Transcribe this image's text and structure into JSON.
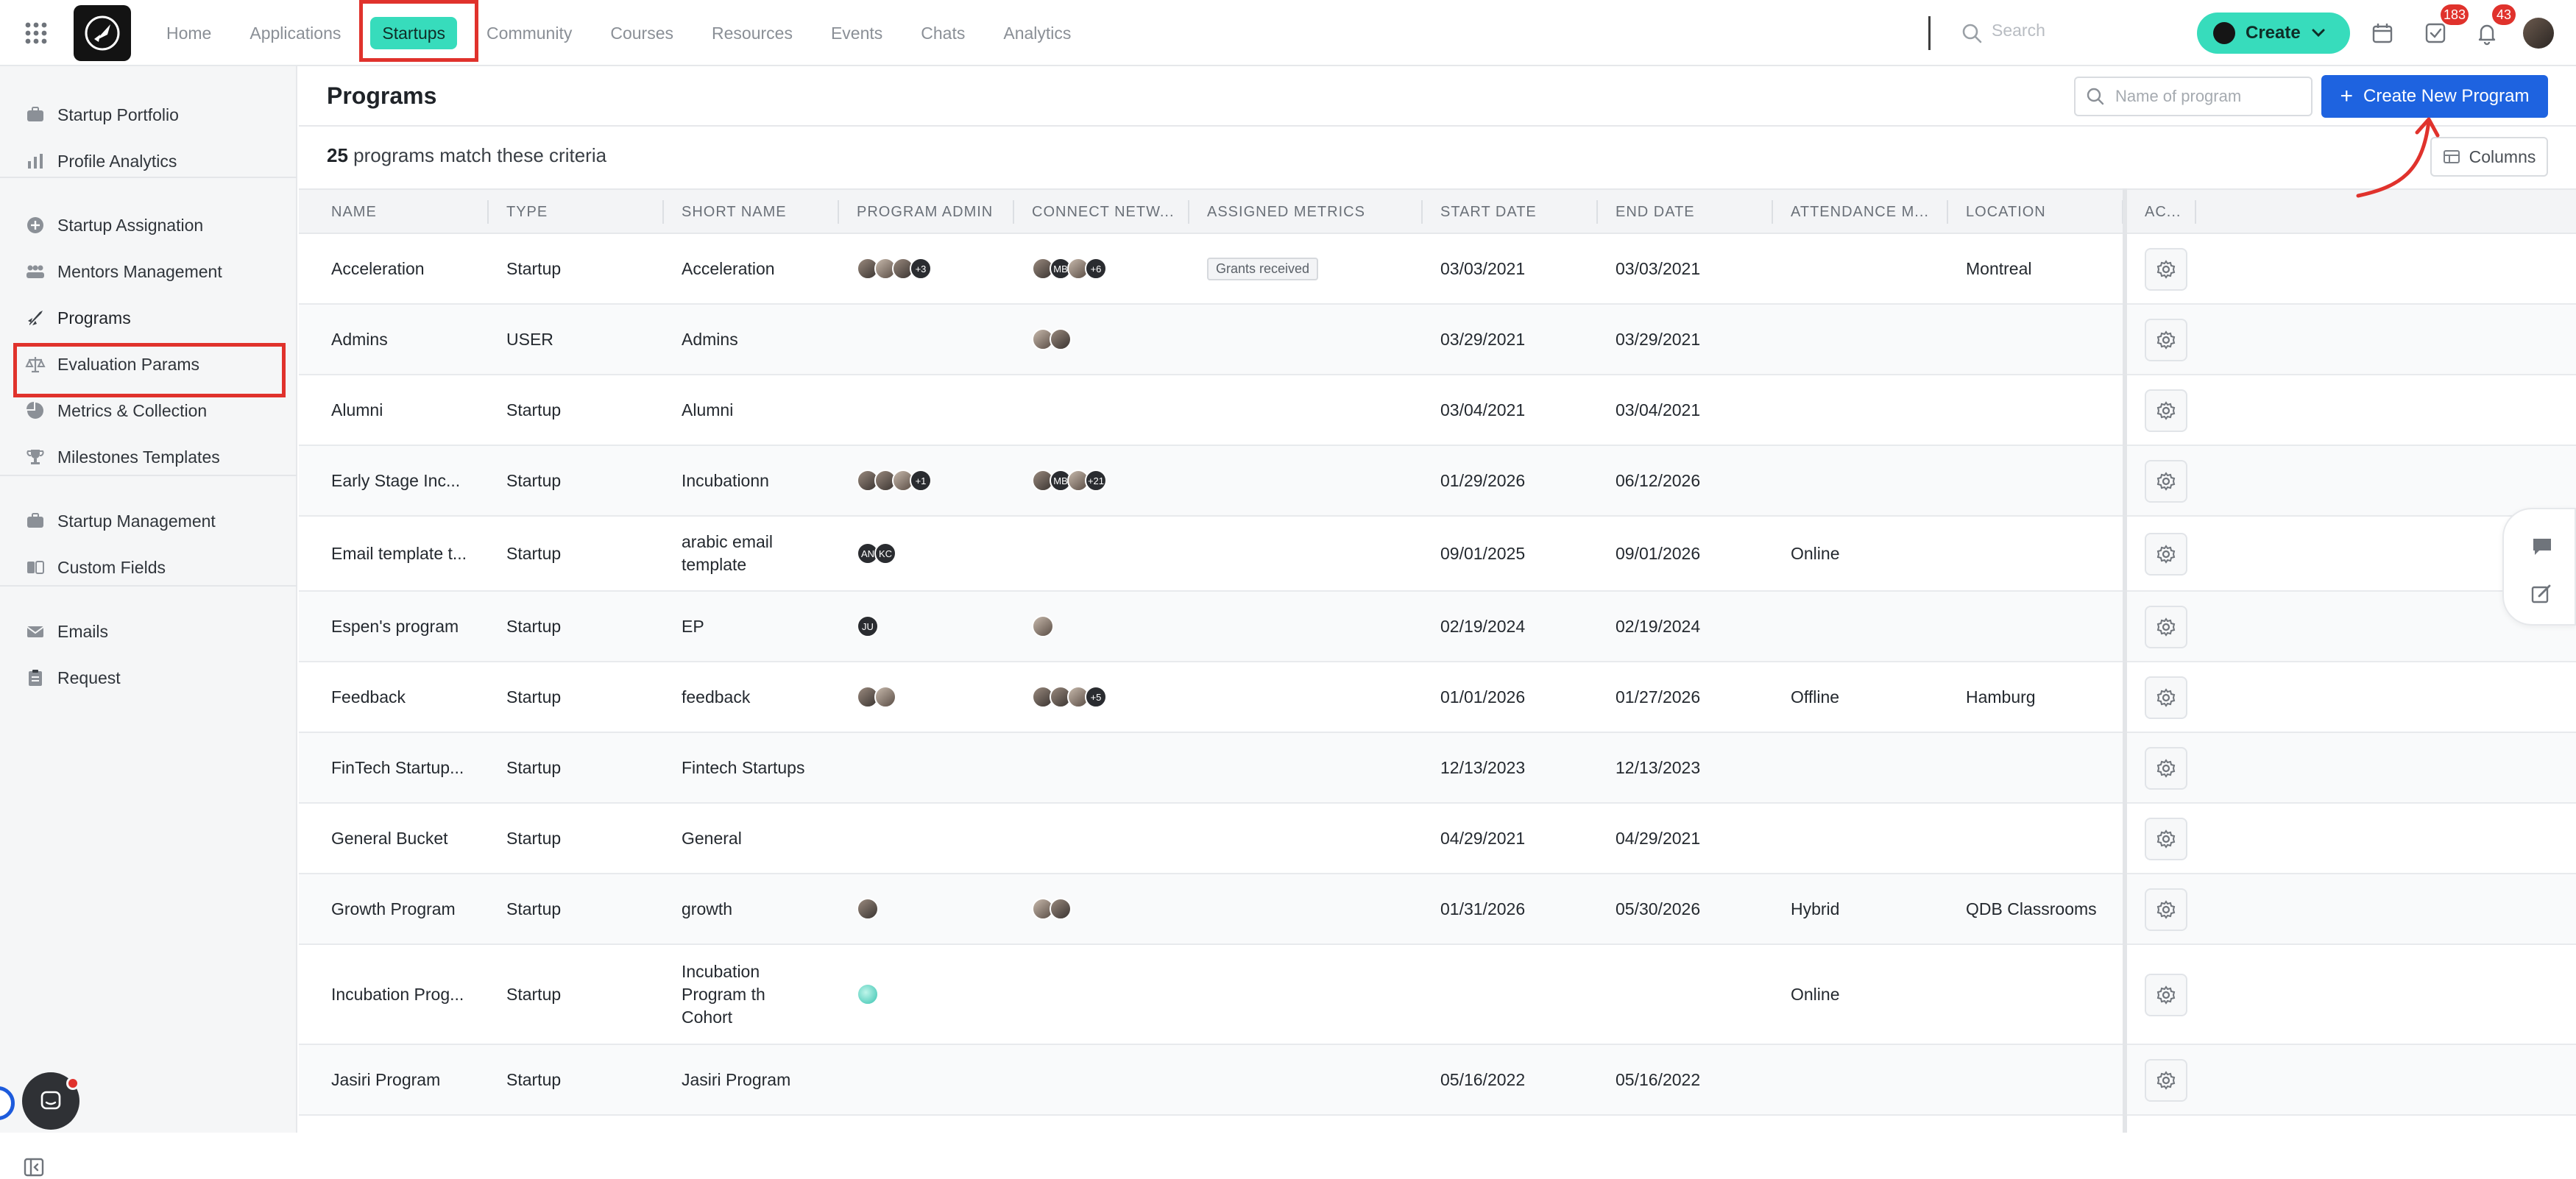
{
  "topnav": {
    "items": [
      {
        "label": "Home",
        "active": false
      },
      {
        "label": "Applications",
        "active": false
      },
      {
        "label": "Startups",
        "active": true
      },
      {
        "label": "Community",
        "active": false
      },
      {
        "label": "Courses",
        "active": false
      },
      {
        "label": "Resources",
        "active": false
      },
      {
        "label": "Events",
        "active": false
      },
      {
        "label": "Chats",
        "active": false
      },
      {
        "label": "Analytics",
        "active": false
      }
    ],
    "search_placeholder": "Search",
    "create_label": "Create",
    "tasks_badge": "183",
    "notifications_badge": "43"
  },
  "sidebar": {
    "groups": [
      [
        {
          "label": "Startup Portfolio",
          "icon": "briefcase-icon"
        },
        {
          "label": "Profile Analytics",
          "icon": "bar-chart-icon"
        }
      ],
      [
        {
          "label": "Startup Assignation",
          "icon": "plus-circle-icon"
        },
        {
          "label": "Mentors Management",
          "icon": "users-icon"
        },
        {
          "label": "Programs",
          "icon": "rocket-icon",
          "active": true
        },
        {
          "label": "Evaluation Params",
          "icon": "scale-icon"
        },
        {
          "label": "Metrics & Collection",
          "icon": "pie-chart-icon"
        },
        {
          "label": "Milestones Templates",
          "icon": "trophy-icon"
        }
      ],
      [
        {
          "label": "Startup Management",
          "icon": "briefcase-icon"
        },
        {
          "label": "Custom Fields",
          "icon": "fields-icon"
        }
      ],
      [
        {
          "label": "Emails",
          "icon": "mail-icon"
        },
        {
          "label": "Request",
          "icon": "clipboard-icon"
        }
      ]
    ]
  },
  "page": {
    "title": "Programs",
    "search_placeholder": "Name of program",
    "create_program_label": "Create New Program",
    "count": "25",
    "count_suffix": "programs match these criteria",
    "columns_label": "Columns"
  },
  "table": {
    "columns": [
      "Name",
      "Type",
      "Short Name",
      "Program Admin",
      "Connect Netw...",
      "Assigned Metrics",
      "Start Date",
      "End Date",
      "Attendance M...",
      "Location",
      "Ac..."
    ],
    "rows": [
      {
        "name": "Acceleration",
        "type": "Startup",
        "short": "Acceleration",
        "admins": [
          "ph",
          "ph2",
          "ph"
        ],
        "admins_more": "+3",
        "network": [
          "ph",
          "MB",
          "ph2"
        ],
        "network_more": "+6",
        "metric": "Grants received",
        "start": "03/03/2021",
        "end": "03/03/2021",
        "attendance": "",
        "location": "Montreal"
      },
      {
        "name": "Admins",
        "type": "USER",
        "short": "Admins",
        "admins": [],
        "admins_more": "",
        "network": [
          "ph2",
          "ph"
        ],
        "network_more": "",
        "metric": "",
        "start": "03/29/2021",
        "end": "03/29/2021",
        "attendance": "",
        "location": ""
      },
      {
        "name": "Alumni",
        "type": "Startup",
        "short": "Alumni",
        "admins": [],
        "admins_more": "",
        "network": [],
        "network_more": "",
        "metric": "",
        "start": "03/04/2021",
        "end": "03/04/2021",
        "attendance": "",
        "location": ""
      },
      {
        "name": "Early Stage Inc...",
        "type": "Startup",
        "short": "Incubationn",
        "admins": [
          "ph",
          "ph",
          "ph2"
        ],
        "admins_more": "+1",
        "network": [
          "ph",
          "MB",
          "ph2"
        ],
        "network_more": "+21",
        "metric": "",
        "start": "01/29/2026",
        "end": "06/12/2026",
        "attendance": "",
        "location": ""
      },
      {
        "name": "Email template t...",
        "type": "Startup",
        "short": "arabic email template",
        "admins": [
          "AN",
          "KC"
        ],
        "admins_more": "",
        "network": [],
        "network_more": "",
        "metric": "",
        "start": "09/01/2025",
        "end": "09/01/2026",
        "attendance": "Online",
        "location": ""
      },
      {
        "name": "Espen's program",
        "type": "Startup",
        "short": "EP",
        "admins": [
          "JU"
        ],
        "admins_more": "",
        "network": [
          "ph2"
        ],
        "network_more": "",
        "metric": "",
        "start": "02/19/2024",
        "end": "02/19/2024",
        "attendance": "",
        "location": ""
      },
      {
        "name": "Feedback",
        "type": "Startup",
        "short": "feedback",
        "admins": [
          "ph",
          "ph2"
        ],
        "admins_more": "",
        "network": [
          "ph",
          "ph",
          "ph2"
        ],
        "network_more": "+5",
        "metric": "",
        "start": "01/01/2026",
        "end": "01/27/2026",
        "attendance": "Offline",
        "location": "Hamburg"
      },
      {
        "name": "FinTech Startup...",
        "type": "Startup",
        "short": "Fintech Startups",
        "admins": [],
        "admins_more": "",
        "network": [],
        "network_more": "",
        "metric": "",
        "start": "12/13/2023",
        "end": "12/13/2023",
        "attendance": "",
        "location": ""
      },
      {
        "name": "General Bucket",
        "type": "Startup",
        "short": "General",
        "admins": [],
        "admins_more": "",
        "network": [],
        "network_more": "",
        "metric": "",
        "start": "04/29/2021",
        "end": "04/29/2021",
        "attendance": "",
        "location": ""
      },
      {
        "name": "Growth Program",
        "type": "Startup",
        "short": "growth",
        "admins": [
          "ph"
        ],
        "admins_more": "",
        "network": [
          "ph2",
          "ph"
        ],
        "network_more": "",
        "metric": "",
        "start": "01/31/2026",
        "end": "05/30/2026",
        "attendance": "Hybrid",
        "location": "QDB Classrooms"
      },
      {
        "name": "Incubation Prog...",
        "type": "Startup",
        "short": "Incubation Program th Cohort",
        "admins": [
          "teal"
        ],
        "admins_more": "",
        "network": [],
        "network_more": "",
        "metric": "",
        "start": "",
        "end": "",
        "attendance": "Online",
        "location": ""
      },
      {
        "name": "Jasiri Program",
        "type": "Startup",
        "short": "Jasiri Program",
        "admins": [],
        "admins_more": "",
        "network": [],
        "network_more": "",
        "metric": "",
        "start": "05/16/2022",
        "end": "05/16/2022",
        "attendance": "",
        "location": ""
      }
    ]
  }
}
